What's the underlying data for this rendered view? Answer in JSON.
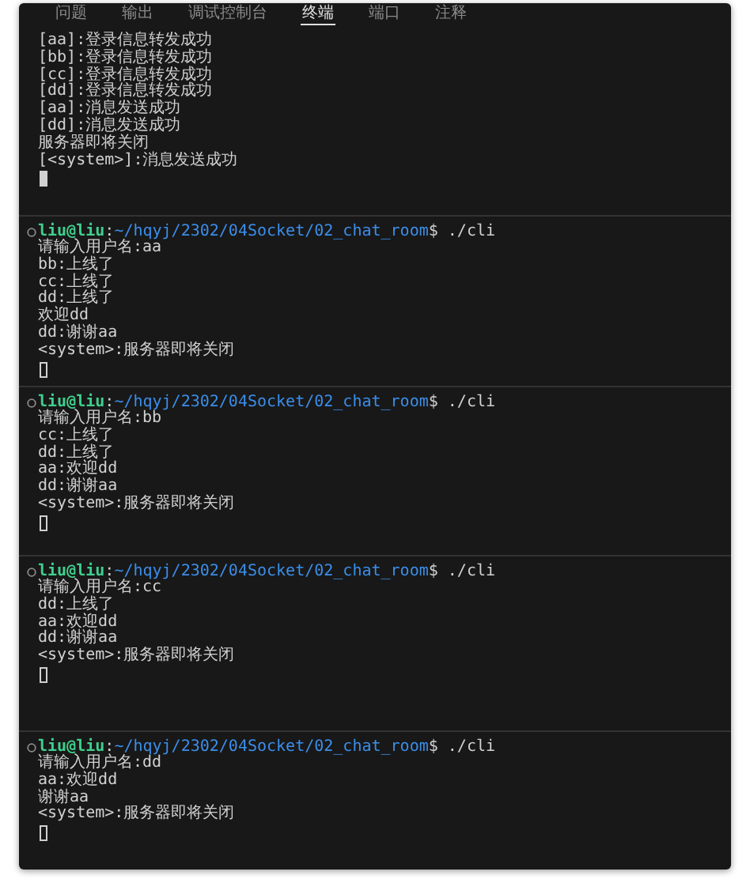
{
  "tabs": [
    {
      "label": "问题",
      "selected": false
    },
    {
      "label": "输出",
      "selected": false
    },
    {
      "label": "调试控制台",
      "selected": false
    },
    {
      "label": "终端",
      "selected": true
    },
    {
      "label": "端口",
      "selected": false
    },
    {
      "label": "注释",
      "selected": false
    }
  ],
  "sessions": [
    {
      "lines": [
        "[aa]:登录信息转发成功",
        "[bb]:登录信息转发成功",
        "[cc]:登录信息转发成功",
        "[dd]:登录信息转发成功",
        "[aa]:消息发送成功",
        "[dd]:消息发送成功",
        "服务器即将关闭",
        "[<system>]:消息发送成功"
      ],
      "cursor_filled": true
    },
    {
      "prompt": [
        {
          "text": "liu@liu",
          "kind": "user"
        },
        {
          "text": ":",
          "kind": "plain"
        },
        {
          "text": "~/hqyj/2302/04Socket/02_chat_room",
          "kind": "path"
        },
        {
          "text": "$ ./cli",
          "kind": "plain"
        }
      ],
      "lines": [
        "请输入用户名:aa",
        "bb:上线了",
        "cc:上线了",
        "dd:上线了",
        "欢迎dd",
        "dd:谢谢aa",
        "<system>:服务器即将关闭"
      ],
      "cursor_filled": false
    },
    {
      "prompt": [
        {
          "text": "liu@liu",
          "kind": "user"
        },
        {
          "text": ":",
          "kind": "plain"
        },
        {
          "text": "~/hqyj/2302/04Socket/02_chat_room",
          "kind": "path"
        },
        {
          "text": "$ ./cli",
          "kind": "plain"
        }
      ],
      "lines": [
        "请输入用户名:bb",
        "cc:上线了",
        "dd:上线了",
        "aa:欢迎dd",
        "dd:谢谢aa",
        "<system>:服务器即将关闭"
      ],
      "cursor_filled": false
    },
    {
      "prompt": [
        {
          "text": "liu@liu",
          "kind": "user"
        },
        {
          "text": ":",
          "kind": "plain"
        },
        {
          "text": "~/hqyj/2302/04Socket/02_chat_room",
          "kind": "path"
        },
        {
          "text": "$ ./cli",
          "kind": "plain"
        }
      ],
      "lines": [
        "请输入用户名:cc",
        "dd:上线了",
        "aa:欢迎dd",
        "dd:谢谢aa",
        "<system>:服务器即将关闭"
      ],
      "cursor_filled": false
    },
    {
      "prompt": [
        {
          "text": "liu@liu",
          "kind": "user"
        },
        {
          "text": ":",
          "kind": "plain"
        },
        {
          "text": "~/hqyj/2302/04Socket/02_chat_room",
          "kind": "path"
        },
        {
          "text": "$ ./cli",
          "kind": "plain"
        }
      ],
      "lines": [
        "请输入用户名:dd",
        "aa:欢迎dd",
        "谢谢aa",
        "<system>:服务器即将关闭"
      ],
      "cursor_filled": false
    }
  ]
}
